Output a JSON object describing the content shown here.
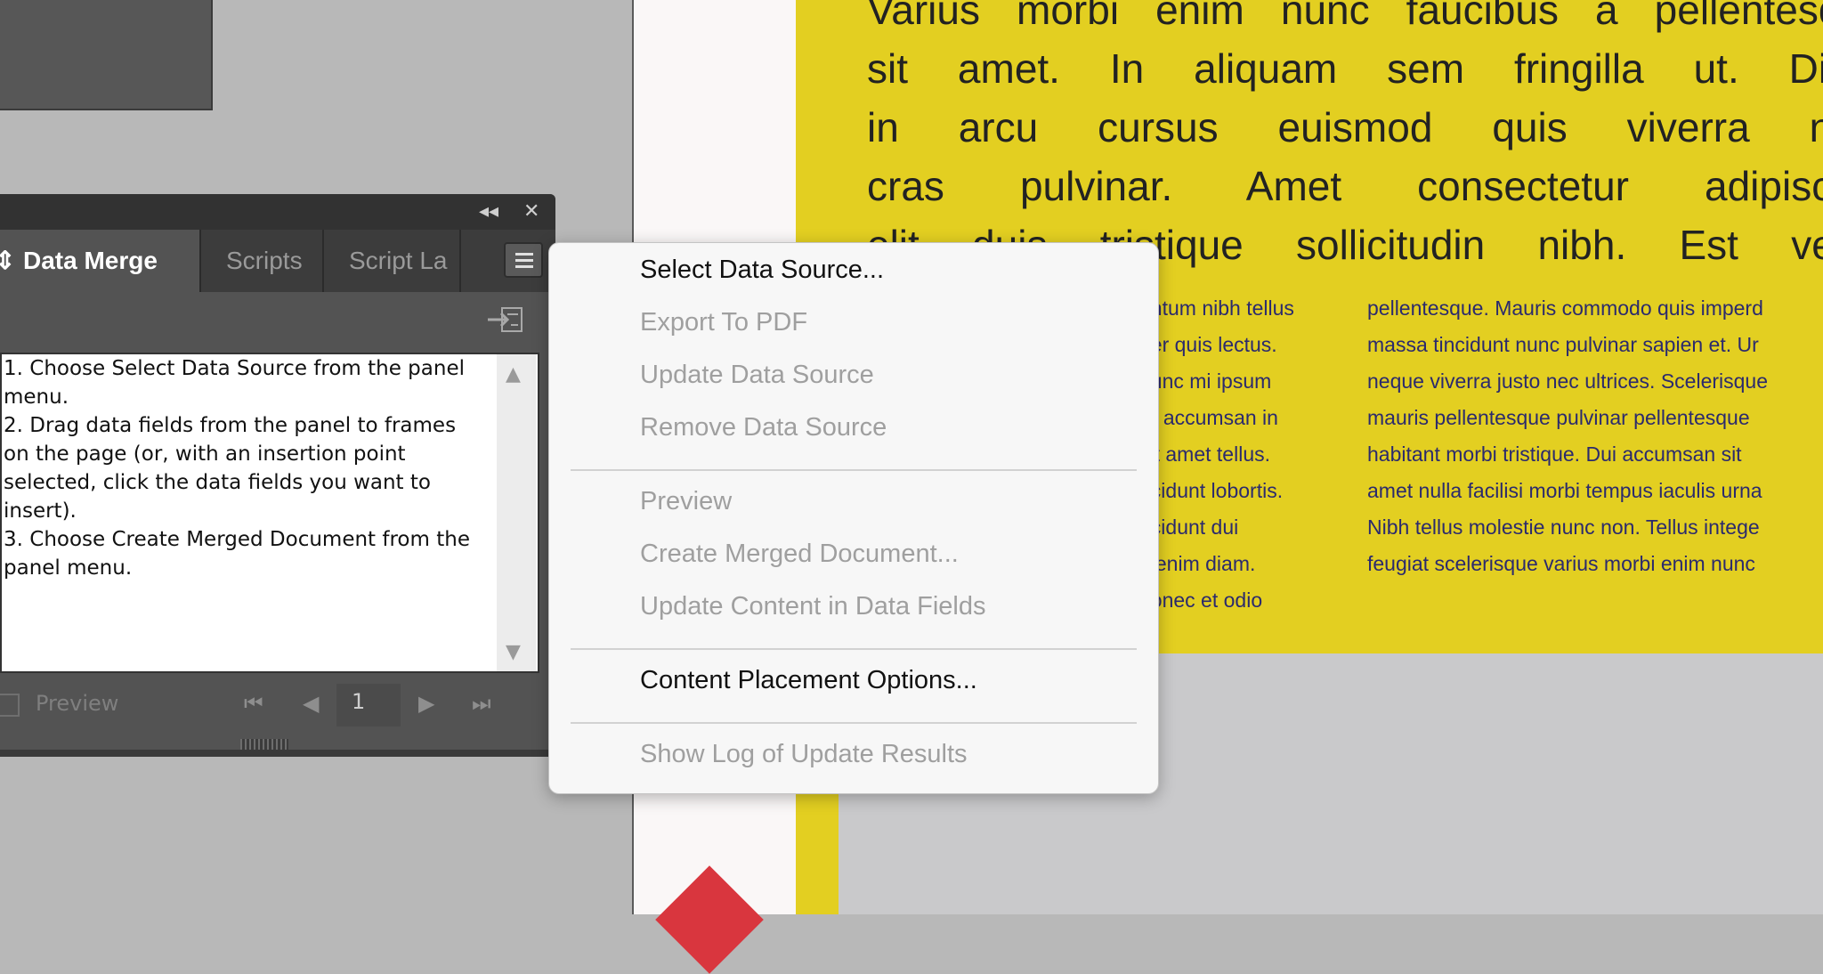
{
  "document": {
    "heading_lines": [
      "Varius morbi enim nunc faucibus a pellentesqu",
      "sit amet. In aliquam sem fringilla ut. Diar",
      "in arcu cursus euismod quis viverra nib",
      "cras pulvinar. Amet consectetur adipiscin",
      "elit duis tristique sollicitudin nibh. Est velit"
    ],
    "column1_lines": [
      "entum nibh tellus",
      "per quis lectus.",
      "nunc mi ipsum",
      "ra accumsan in",
      "sit amet tellus.",
      "ncidunt lobortis.",
      "ncidunt dui",
      "c enim diam.",
      " donec et odio"
    ],
    "column2_lines": [
      "pellentesque. Mauris commodo quis imperd",
      "massa tincidunt nunc pulvinar sapien et. Ur",
      "neque viverra justo nec ultrices. Scelerisque",
      "mauris pellentesque pulvinar pellentesque",
      "habitant morbi tristique. Dui accumsan sit",
      "amet nulla facilisi morbi tempus iaculis urna",
      "Nibh tellus molestie nunc non. Tellus intege",
      "feugiat scelerisque varius morbi enim nunc"
    ],
    "colors": {
      "frame": "#e3cf21",
      "column_text": "#2b2a6d",
      "accent_shape": "#d9363e"
    }
  },
  "panel": {
    "titlebar": {
      "collapse_icon": "double-chevron-left-icon",
      "close_icon": "close-icon",
      "collapse_glyph": "◂◂",
      "close_glyph": "✕"
    },
    "tabs": [
      {
        "label": "Data Merge",
        "active": true,
        "icon_glyph": "⇕"
      },
      {
        "label": "Scripts",
        "active": false
      },
      {
        "label": "Script La",
        "active": false
      }
    ],
    "instructions": [
      "1. Choose Select Data Source from the panel",
      "menu.",
      "2. Drag data fields from the panel to frames",
      "on the page (or, with an insertion point",
      "selected, click the data fields you want to",
      "insert).",
      "3. Choose Create Merged Document from the",
      "panel menu."
    ],
    "preview_label": "Preview",
    "preview_checked": false,
    "page_number": "1",
    "nav": {
      "first": "⏮",
      "prev": "◀",
      "next": "▶",
      "last": "⏭"
    }
  },
  "context_menu": {
    "items": [
      {
        "label": "Select Data Source...",
        "enabled": true
      },
      {
        "label": "Export To PDF",
        "enabled": false
      },
      {
        "label": "Update Data Source",
        "enabled": false
      },
      {
        "label": "Remove Data Source",
        "enabled": false
      },
      {
        "label": "Preview",
        "enabled": false
      },
      {
        "label": "Create Merged Document...",
        "enabled": false
      },
      {
        "label": "Update Content in Data Fields",
        "enabled": false
      },
      {
        "label": "Content Placement Options...",
        "enabled": true
      },
      {
        "label": "Show Log of Update Results",
        "enabled": false
      }
    ]
  }
}
